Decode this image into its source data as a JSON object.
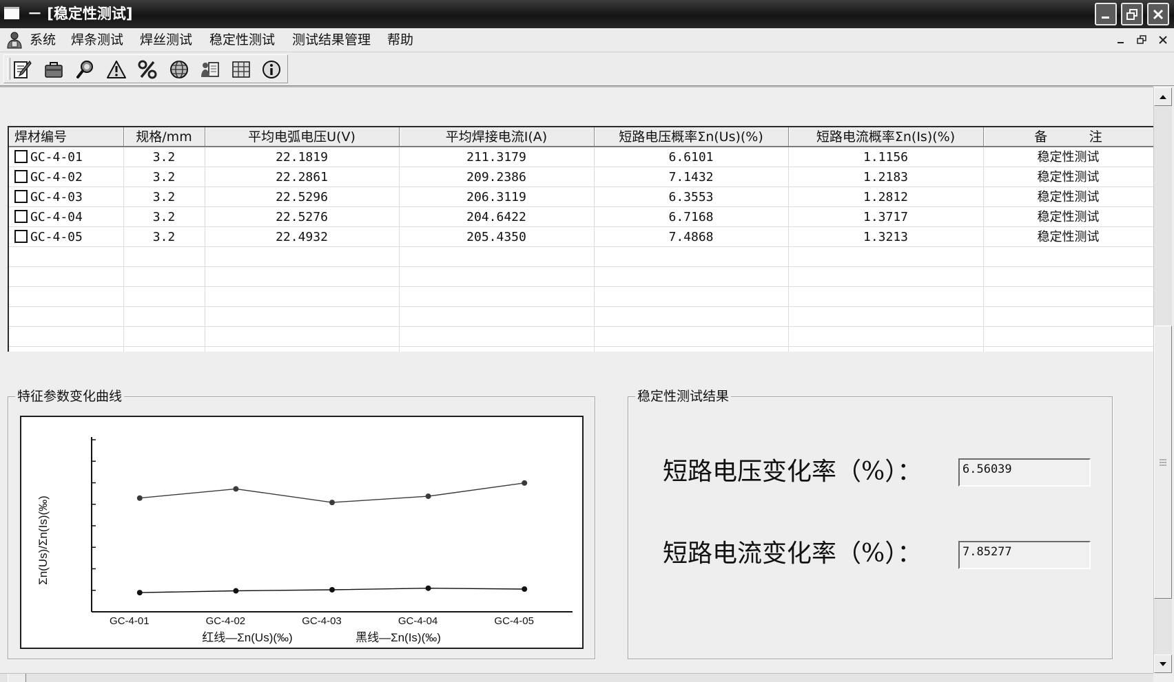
{
  "window": {
    "title": "－ [稳定性测试]",
    "icon": "window-icon",
    "buttons": [
      "minimize-icon",
      "restore-icon",
      "close-icon"
    ]
  },
  "menu": {
    "icon": "system-user-icon",
    "items": [
      "系统",
      "焊条测试",
      "焊丝测试",
      "稳定性测试",
      "测试结果管理",
      "帮助"
    ],
    "mdi_buttons": [
      "minimize-icon",
      "restore-icon",
      "close-icon"
    ]
  },
  "toolbar": {
    "icons": [
      "edit-icon",
      "open-icon",
      "probe-icon",
      "warning-icon",
      "percent-icon",
      "globe-icon",
      "user-document-icon",
      "grid-icon",
      "info-icon"
    ]
  },
  "table": {
    "headers": [
      "焊材编号",
      "规格/mm",
      "平均电弧电压U(V)",
      "平均焊接电流I(A)",
      "短路电压概率Σn(Us)(%)",
      "短路电流概率Σn(Is)(%)",
      "备          注"
    ],
    "rows": [
      {
        "id": "GC-4-01",
        "spec": "3.2",
        "u": "22.1819",
        "i": "211.3179",
        "sn_us": "6.6101",
        "sn_is": "1.1156",
        "note": "稳定性测试"
      },
      {
        "id": "GC-4-02",
        "spec": "3.2",
        "u": "22.2861",
        "i": "209.2386",
        "sn_us": "7.1432",
        "sn_is": "1.2183",
        "note": "稳定性测试"
      },
      {
        "id": "GC-4-03",
        "spec": "3.2",
        "u": "22.5296",
        "i": "206.3119",
        "sn_us": "6.3553",
        "sn_is": "1.2812",
        "note": "稳定性测试"
      },
      {
        "id": "GC-4-04",
        "spec": "3.2",
        "u": "22.5276",
        "i": "204.6422",
        "sn_us": "6.7168",
        "sn_is": "1.3717",
        "note": "稳定性测试"
      },
      {
        "id": "GC-4-05",
        "spec": "3.2",
        "u": "22.4932",
        "i": "205.4350",
        "sn_us": "7.4868",
        "sn_is": "1.3213",
        "note": "稳定性测试"
      }
    ]
  },
  "chart_panel": {
    "title": "特征参数变化曲线"
  },
  "result_panel": {
    "title": "稳定性测试结果",
    "voltage_label": "短路电压变化率（%）：",
    "voltage_value": "6.56039",
    "current_label": "短路电流变化率（%）：",
    "current_value": "7.85277"
  },
  "colors": {
    "title_bar": "#1e1e1e",
    "content_bg": "#eeeeee",
    "table_bg": "#ffffff",
    "axis": "#111111"
  },
  "chart_data": {
    "type": "line",
    "categories": [
      "GC-4-01",
      "GC-4-02",
      "GC-4-03",
      "GC-4-04",
      "GC-4-05"
    ],
    "series": [
      {
        "name": "红线—Σn(Us)(‰)",
        "values": [
          6.6101,
          7.1432,
          6.3553,
          6.7168,
          7.4868
        ],
        "color": "#3a3a3a"
      },
      {
        "name": "黑线—Σn(Is)(‰)",
        "values": [
          1.1156,
          1.2183,
          1.2812,
          1.3717,
          1.3213
        ],
        "color": "#111111"
      }
    ],
    "ylabel": "Σn(Us)/Σn(Is)(‰)",
    "ylim": [
      0,
      10
    ],
    "y_tick_labels_shown": false,
    "grid": false,
    "legend": "bottom"
  }
}
